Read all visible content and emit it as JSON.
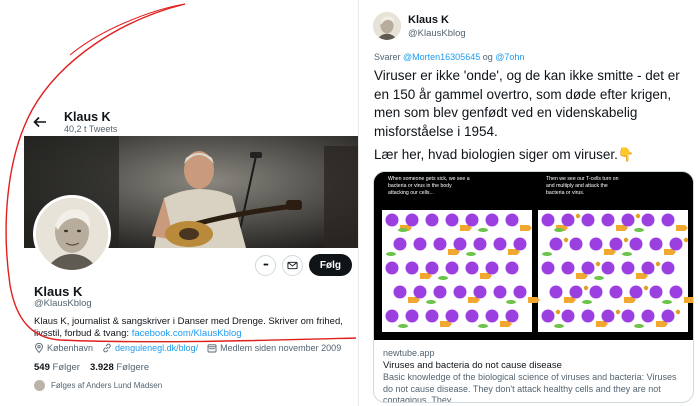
{
  "profile": {
    "header_name": "Klaus K",
    "tweet_count": "40,2 t Tweets",
    "display_name": "Klaus K",
    "handle": "@KlausKblog",
    "bio_text": "Klaus K, journalist & sangskriver i Danser med Drenge. Skriver om frihed, livsstil, forbud & tvang: ",
    "bio_link": "facebook.com/KlausKblog",
    "location": "København",
    "website": "dengulenegl.dk/blog/",
    "joined": "Medlem siden november 2009",
    "following_count": "549",
    "following_label": "Følger",
    "followers_count": "3.928",
    "followers_label": "Følgere",
    "followed_by": "Følges af Anders Lund Madsen",
    "follow_button": "Følg",
    "more_button": "•••"
  },
  "tweet": {
    "name": "Klaus K",
    "handle": "@KlausKblog",
    "reply_prefix": "Svarer ",
    "reply_user1": "@Morten16305645",
    "reply_and": " og ",
    "reply_user2": "@7ohn",
    "text": "Viruser er ikke 'onde', og de kan ikke smitte - det er en 150 år gammel overtro, som døde efter krigen, men som blev genfødt ved en videnskabelig misforståelse i 1954.",
    "text2": "Lær her, hvad biologien siger om viruser.👇"
  },
  "card": {
    "caption_left": "When someone gets sick, we see a bacteria or virus in the body attacking our cells...",
    "caption_right": "Then we see our T-cells turn on and multiply and attack the bacteria or virus.",
    "domain": "newtube.app",
    "title": "Viruses and bacteria do not cause disease",
    "description": "Basic knowledge of the biological science of viruses and bacteria: Viruses do not cause disease. They don't attack healthy cells and they are not contagious. They..."
  },
  "colors": {
    "accent": "#1d9bf0",
    "annotation_red": "#e0201f",
    "text": "#0f1419",
    "muted": "#536471",
    "cell_purple": "#9b3fe0"
  },
  "icons": [
    "back-arrow-icon",
    "location-icon",
    "link-icon",
    "calendar-icon",
    "mail-icon",
    "pointing-down-emoji"
  ]
}
